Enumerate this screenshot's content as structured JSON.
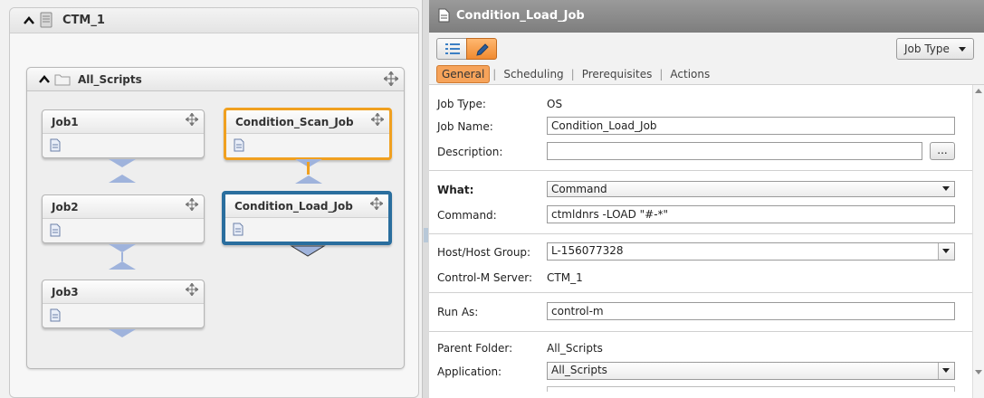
{
  "workspace": {
    "server_title": "CTM_1",
    "folder": {
      "title": "All_Scripts",
      "jobs": [
        {
          "name": "Job1"
        },
        {
          "name": "Job2"
        },
        {
          "name": "Job3"
        },
        {
          "name": "Condition_Scan_Job"
        },
        {
          "name": "Condition_Load_Job"
        }
      ]
    }
  },
  "properties": {
    "title": "Condition_Load_Job",
    "job_type_button": "Job Type",
    "tabs": [
      "General",
      "Scheduling",
      "Prerequisites",
      "Actions"
    ],
    "active_tab": "General",
    "fields": {
      "job_type_label": "Job Type:",
      "job_type_value": "OS",
      "job_name_label": "Job Name:",
      "job_name_value": "Condition_Load_Job",
      "description_label": "Description:",
      "description_value": "",
      "description_button": "...",
      "what_label": "What:",
      "what_value": "Command",
      "command_label": "Command:",
      "command_value": "ctmldnrs -LOAD \"#-*\"",
      "host_label": "Host/Host Group:",
      "host_value": "L-156077328",
      "server_label": "Control-M Server:",
      "server_value": "CTM_1",
      "run_as_label": "Run As:",
      "run_as_value": "control-m",
      "parent_folder_label": "Parent Folder:",
      "parent_folder_value": "All_Scripts",
      "application_label": "Application:",
      "application_value": "All_Scripts"
    }
  },
  "colors": {
    "selected_job_border": "#2a6e9e",
    "predecessor_job_border": "#f0a020",
    "active_tab": "#f6a35a",
    "header_bar": "#8a8a8a"
  }
}
